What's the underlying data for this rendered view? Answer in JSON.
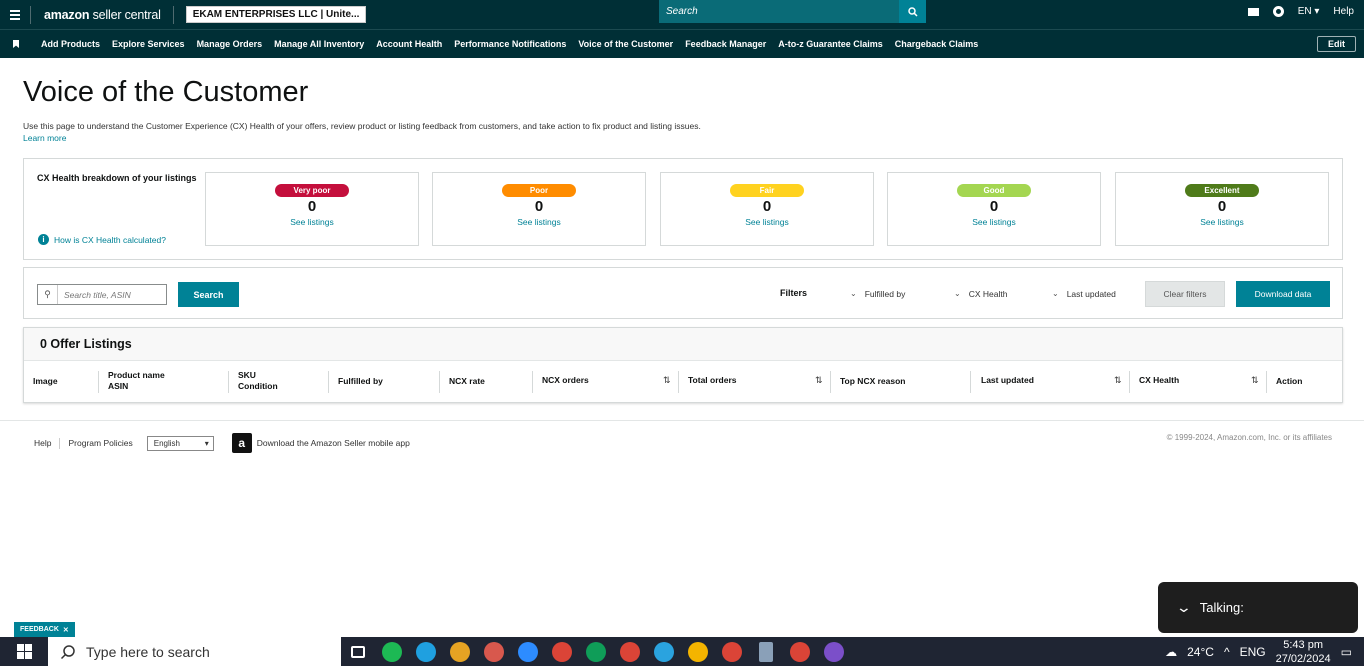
{
  "topbar": {
    "logo_main": "amazon",
    "logo_sub": "seller central",
    "account": "EKAM ENTERPRISES LLC | Unite...",
    "search_placeholder": "Search",
    "language": "EN",
    "help": "Help"
  },
  "nav": {
    "items": [
      "Add Products",
      "Explore Services",
      "Manage Orders",
      "Manage All Inventory",
      "Account Health",
      "Performance Notifications",
      "Voice of the Customer",
      "Feedback Manager",
      "A-to-z Guarantee Claims",
      "Chargeback Claims"
    ],
    "edit": "Edit"
  },
  "page": {
    "title": "Voice of the Customer",
    "intro": "Use this page to understand the Customer Experience (CX) Health of your offers, review product or listing feedback from customers, and take action to fix product and listing issues.",
    "learn_more": "Learn more"
  },
  "health": {
    "title": "CX Health breakdown of your listings",
    "link": "How is CX Health calculated?",
    "cards": [
      {
        "label": "Very poor",
        "count": "0",
        "link": "See listings",
        "color": "#c40f3c",
        "text_color": "#ffffff"
      },
      {
        "label": "Poor",
        "count": "0",
        "link": "See listings",
        "color": "#ff8c00",
        "text_color": "#ffffff"
      },
      {
        "label": "Fair",
        "count": "0",
        "link": "See listings",
        "color": "#ffd21f",
        "text_color": "#ffffff"
      },
      {
        "label": "Good",
        "count": "0",
        "link": "See listings",
        "color": "#a4d651",
        "text_color": "#ffffff"
      },
      {
        "label": "Excellent",
        "count": "0",
        "link": "See listings",
        "color": "#4f7b1a",
        "text_color": "#ffffff"
      }
    ]
  },
  "filters": {
    "search_placeholder": "Search title, ASIN",
    "search_button": "Search",
    "label": "Filters",
    "fulfilled_by": "Fulfilled by",
    "cx_health": "CX Health",
    "last_updated": "Last updated",
    "clear": "Clear filters",
    "download": "Download data"
  },
  "table": {
    "title": "0 Offer Listings",
    "columns": {
      "image": "Image",
      "product_name": "Product name",
      "asin": "ASIN",
      "sku": "SKU",
      "condition": "Condition",
      "fulfilled_by": "Fulfilled by",
      "ncx_rate": "NCX rate",
      "ncx_orders": "NCX orders",
      "total_orders": "Total orders",
      "top_ncx_reason": "Top NCX reason",
      "last_updated": "Last updated",
      "cx_health": "CX Health",
      "action": "Action"
    }
  },
  "footer": {
    "help": "Help",
    "policies": "Program Policies",
    "language": "English",
    "app": "Download the Amazon Seller mobile app",
    "copyright": "© 1999-2024, Amazon.com, Inc. or its affiliates"
  },
  "feedback": "FEEDBACK",
  "toast": "Talking:",
  "taskbar": {
    "search_placeholder": "Type here to search",
    "weather": "24°C",
    "lang": "ENG",
    "time": "5:43 pm",
    "date": "27/02/2024"
  }
}
